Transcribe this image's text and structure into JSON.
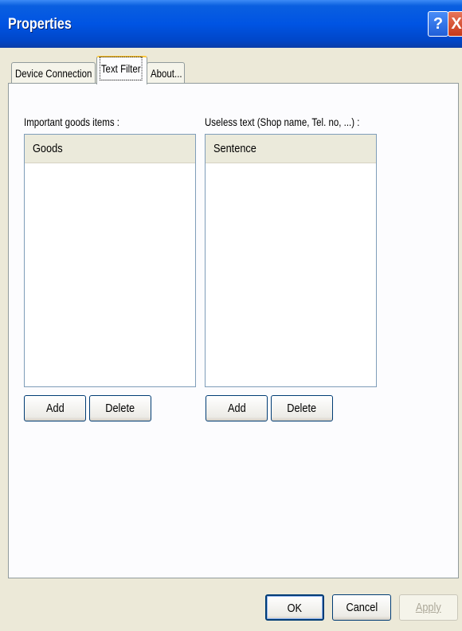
{
  "window": {
    "title": "Properties",
    "help_glyph": "?",
    "close_glyph": "X"
  },
  "tabs": [
    {
      "label": "Device Connection",
      "active": false
    },
    {
      "label": "Text Filter",
      "active": true
    },
    {
      "label": "About...",
      "active": false
    }
  ],
  "goods_section": {
    "label": "Important goods items :",
    "column_header": "Goods",
    "items": [],
    "add_label": "Add",
    "delete_label": "Delete"
  },
  "useless_section": {
    "label": "Useless text (Shop name, Tel. no, ...) :",
    "column_header": "Sentence",
    "items": [],
    "add_label": "Add",
    "delete_label": "Delete"
  },
  "footer": {
    "ok_label": "OK",
    "cancel_label": "Cancel",
    "apply_label": "Apply"
  },
  "colors": {
    "titlebar": "#0054e3",
    "dialog_bg": "#ece9d8",
    "panel_bg": "#fcfcfe",
    "active_tab_accent": "#ffc83c",
    "button_border": "#003c74",
    "close_button": "#c8391a"
  }
}
